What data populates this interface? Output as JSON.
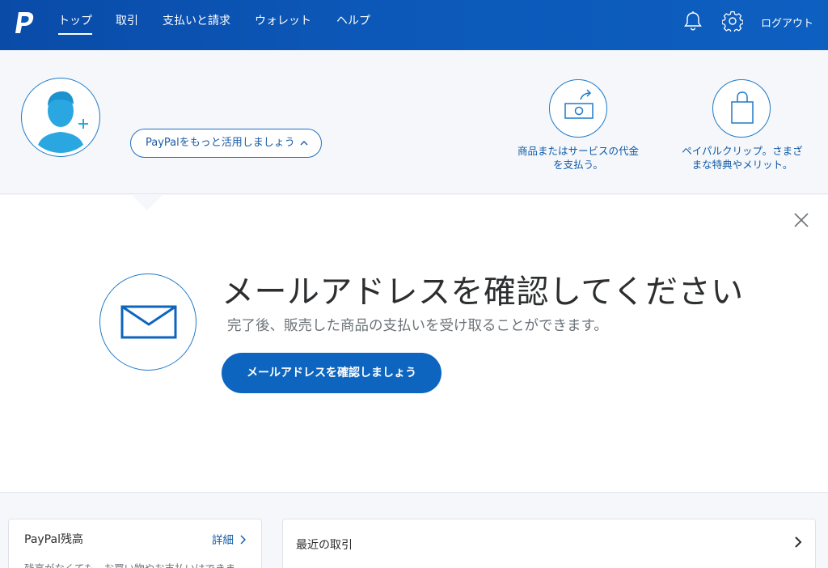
{
  "nav": {
    "items": [
      {
        "label": "トップ",
        "active": true
      },
      {
        "label": "取引",
        "active": false
      },
      {
        "label": "支払いと請求",
        "active": false
      },
      {
        "label": "ウォレット",
        "active": false
      },
      {
        "label": "ヘルプ",
        "active": false
      }
    ],
    "logout": "ログアウト",
    "icons": {
      "logo": "paypal-logo-icon",
      "notifications": "bell-icon",
      "settings": "gear-icon"
    }
  },
  "header": {
    "promo_button": "PayPalをもっと活用しましょう",
    "quick_actions": [
      {
        "line1": "商品またはサービスの代金",
        "line2": "を支払う。",
        "icon": "money-send-icon"
      },
      {
        "line1": "ペイパルクリップ。さまざ",
        "line2": "まな特典やメリット。",
        "icon": "shopping-bag-icon"
      }
    ]
  },
  "confirm_card": {
    "headline": "メールアドレスを確認してください",
    "subtext": "完了後、販売した商品の支払いを受け取ることができます。",
    "cta": "メールアドレスを確認しましょう"
  },
  "balance_panel": {
    "title": "PayPal残高",
    "link": "詳細",
    "text": "残高がなくても、お買い物やお支払いはできま..."
  },
  "transactions_panel": {
    "title": "最近の取引"
  },
  "colors": {
    "nav_bg": "#0c58b8",
    "accent": "#0d65bf",
    "link": "#0f5aa8",
    "avatar": "#29a8e0"
  }
}
